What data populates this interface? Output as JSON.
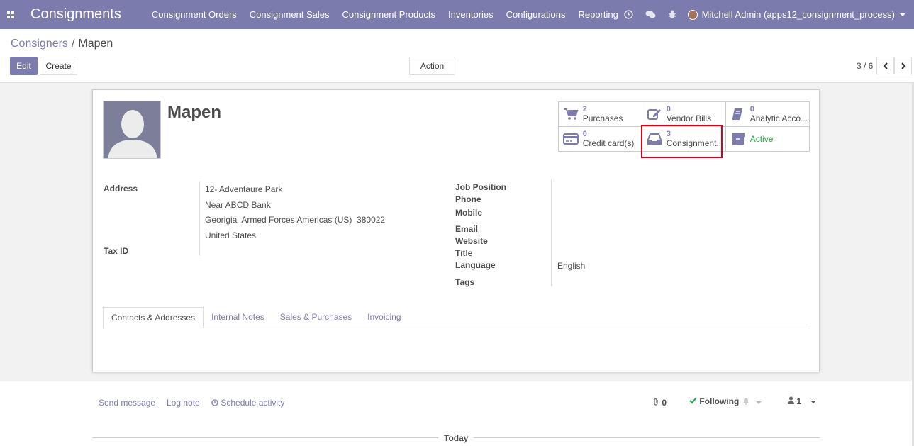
{
  "navbar": {
    "brand": "Consignments",
    "menu": [
      "Consignment Orders",
      "Consignment Sales",
      "Consignment Products",
      "Inventories",
      "Configurations",
      "Reporting"
    ],
    "user": "Mitchell Admin (apps12_consignment_process)"
  },
  "breadcrumb": {
    "parent": "Consigners",
    "separator": "/",
    "current": "Mapen"
  },
  "controls": {
    "edit": "Edit",
    "create": "Create",
    "action": "Action",
    "pager": "3 / 6"
  },
  "record": {
    "name": "Mapen",
    "smart_buttons": [
      {
        "value": "2",
        "label": "Purchases",
        "icon": "cart-icon"
      },
      {
        "value": "0",
        "label": "Vendor Bills",
        "icon": "edit-icon"
      },
      {
        "value": "0",
        "label": "Analytic Acco...",
        "icon": "book-icon"
      },
      {
        "value": "0",
        "label": "Credit card(s)",
        "icon": "credit-card-icon"
      },
      {
        "value": "3",
        "label": "Consignment...",
        "icon": "inbox-icon"
      },
      {
        "value": "",
        "label": "Active",
        "icon": "archive-icon"
      }
    ],
    "left_labels": {
      "address": "Address",
      "tax_id": "Tax ID"
    },
    "address_lines": [
      "12- Adventaure Park",
      "Near ABCD Bank",
      "Georigia  Armed Forces Americas (US)  380022",
      "United States"
    ],
    "right_labels": {
      "job_position": "Job Position",
      "phone": "Phone",
      "mobile": "Mobile",
      "email": "Email",
      "website": "Website",
      "title": "Title",
      "language": "Language",
      "tags": "Tags"
    },
    "language_value": "English"
  },
  "tabs": [
    "Contacts & Addresses",
    "Internal Notes",
    "Sales & Purchases",
    "Invoicing"
  ],
  "chatter": {
    "send_message": "Send message",
    "log_note": "Log note",
    "schedule_activity": "Schedule activity",
    "attachments": "0",
    "following": "Following",
    "followers": "1",
    "today": "Today"
  },
  "colors": {
    "primary": "#7c7bad",
    "highlight": "#d9001b",
    "active": "#28a745"
  }
}
